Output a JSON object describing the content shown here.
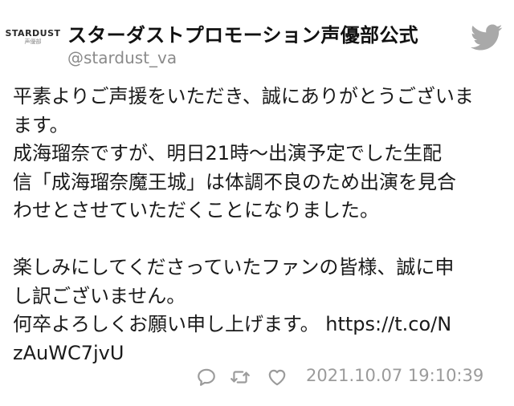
{
  "account": {
    "logo_text": "STARDUST",
    "logo_subtext": "声優部",
    "display_name": "スターダストプロモーション声優部公式",
    "handle": "@stardust_va"
  },
  "tweet": {
    "lines": [
      "平素よりご声援をいただき、誠にありがとうございま",
      "ます。",
      "成海瑠奈ですが、明日21時～出演予定でした生配",
      "信「成海瑠奈魔王城」は体調不良のため出演を見合",
      "わせとさせていただくことになりました。",
      "",
      "楽しみにしてくださっていたファンの皆様、誠に申",
      "し訳ございません。",
      "何卒よろしくお願い申し上げます。 https://t.co/N",
      "zAuWC7jvU"
    ]
  },
  "footer": {
    "timestamp": "2021.10.07 19:10:39"
  },
  "icons": {
    "brand": "twitter-bird-icon",
    "reply": "reply-icon",
    "retweet": "retweet-icon",
    "like": "like-icon"
  },
  "colors": {
    "twitter_bird": "#a9a9a9",
    "icon_gray": "#9b9b9b",
    "text": "#1a1a1a",
    "handle": "#8a8a8a"
  }
}
